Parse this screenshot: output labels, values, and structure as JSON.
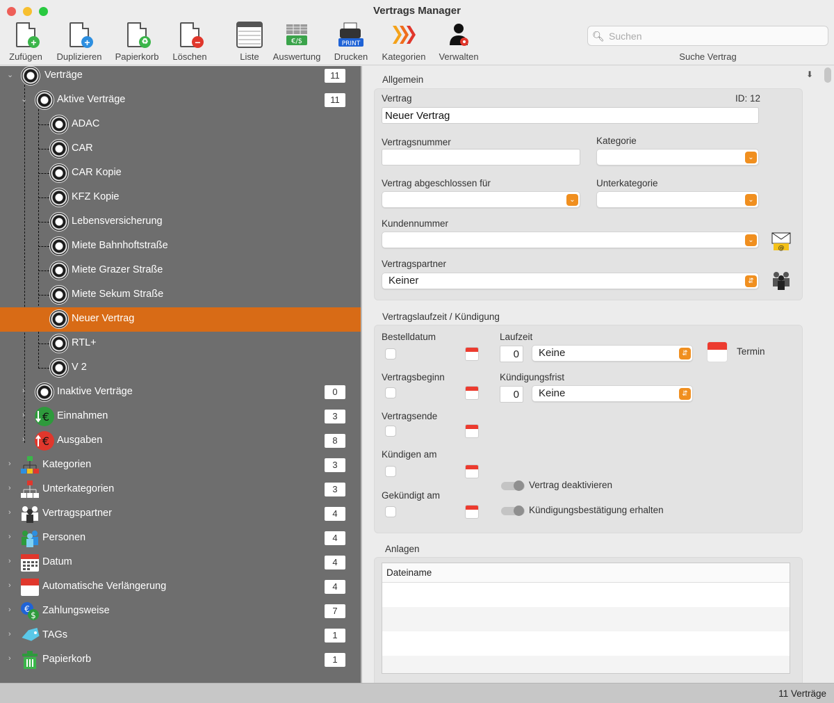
{
  "window": {
    "title": "Vertrags Manager"
  },
  "toolbar": {
    "buttons": [
      {
        "label": "Zufügen"
      },
      {
        "label": "Duplizieren"
      },
      {
        "label": "Papierkorb"
      },
      {
        "label": "Löschen"
      },
      {
        "label": "Liste"
      },
      {
        "label": "Auswertung"
      },
      {
        "label": "Drucken"
      },
      {
        "label": "Kategorien"
      },
      {
        "label": "Verwalten"
      }
    ],
    "search": {
      "placeholder": "Suchen",
      "value": "",
      "label": "Suche Vertrag"
    }
  },
  "sidebar": {
    "items": [
      {
        "label": "Verträge",
        "count": "11"
      },
      {
        "label": "Aktive Verträge",
        "count": "11"
      },
      {
        "label": "ADAC"
      },
      {
        "label": "CAR"
      },
      {
        "label": "CAR Kopie"
      },
      {
        "label": "KFZ Kopie"
      },
      {
        "label": "Lebensversicherung"
      },
      {
        "label": "Miete Bahnhoftstraße"
      },
      {
        "label": "Miete Grazer Straße"
      },
      {
        "label": "Miete Sekum Straße"
      },
      {
        "label": "Neuer Vertrag",
        "selected": true
      },
      {
        "label": "RTL+"
      },
      {
        "label": "V 2"
      },
      {
        "label": "Inaktive Verträge",
        "count": "0"
      },
      {
        "label": "Einnahmen",
        "count": "3"
      },
      {
        "label": "Ausgaben",
        "count": "8"
      },
      {
        "label": "Kategorien",
        "count": "3"
      },
      {
        "label": "Unterkategorien",
        "count": "3"
      },
      {
        "label": "Vertragspartner",
        "count": "4"
      },
      {
        "label": "Personen",
        "count": "4"
      },
      {
        "label": "Datum",
        "count": "4"
      },
      {
        "label": "Automatische Verlängerung",
        "count": "4"
      },
      {
        "label": "Zahlungsweise",
        "count": "7"
      },
      {
        "label": "TAGs",
        "count": "1"
      },
      {
        "label": "Papierkorb",
        "count": "1"
      }
    ]
  },
  "form": {
    "general": {
      "section_title": "Allgemein",
      "contract_label": "Vertrag",
      "id_label": "ID: 12",
      "contract_value": "Neuer Vertrag",
      "contract_number_label": "Vertragsnummer",
      "contract_number_value": "",
      "category_label": "Kategorie",
      "category_value": "",
      "concluded_for_label": "Vertrag abgeschlossen für",
      "concluded_for_value": "",
      "subcategory_label": "Unterkategorie",
      "subcategory_value": "",
      "customer_number_label": "Kundennummer",
      "customer_number_value": "",
      "partner_label": "Vertragspartner",
      "partner_value": "Keiner"
    },
    "term": {
      "section_title": "Vertragslaufzeit / Kündigung",
      "order_date_label": "Bestelldatum",
      "start_label": "Vertragsbeginn",
      "end_label": "Vertragsende",
      "cancel_on_label": "Kündigen am",
      "cancelled_on_label": "Gekündigt am",
      "duration_label": "Laufzeit",
      "duration_number": "0",
      "duration_unit": "Keine",
      "notice_label": "Kündigungsfrist",
      "notice_number": "0",
      "notice_unit": "Keine",
      "appointment_label": "Termin",
      "deactivate_label": "Vertrag deaktivieren",
      "confirmation_label": "Kündigungsbestätigung erhalten"
    },
    "attachments": {
      "section_title": "Anlagen",
      "column_filename": "Dateiname"
    }
  },
  "status": {
    "text": "11 Verträge"
  },
  "colors": {
    "accent": "#d86b16",
    "sidebar_bg": "#6e6e6e",
    "dropdown_arrow": "#f08f1f"
  }
}
